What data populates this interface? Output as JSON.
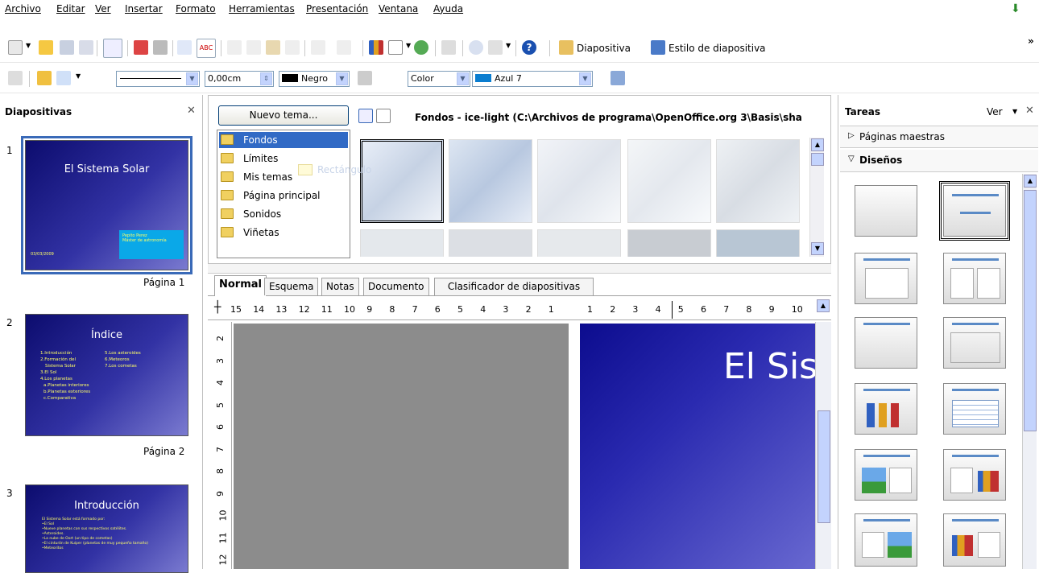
{
  "menu": [
    "Archivo",
    "Editar",
    "Ver",
    "Insertar",
    "Formato",
    "Herramientas",
    "Presentación",
    "Ventana",
    "Ayuda"
  ],
  "toolbar2": {
    "slide_label": "Diapositiva",
    "slide_design_label": "Estilo de diapositiva",
    "more": "»"
  },
  "toolbar3": {
    "line_width": "0,00cm",
    "line_color": "Negro",
    "area_style": "Color",
    "area_color": "Azul 7"
  },
  "slides_panel": {
    "title": "Diapositivas",
    "close": "✕",
    "slides": [
      {
        "num": "1",
        "title": "El Sistema Solar",
        "caption": "Página 1",
        "box_line1": "Pepito Perez",
        "box_line2": "Máster de astronomía",
        "date": "03/03/2009"
      },
      {
        "num": "2",
        "title": "Índice",
        "caption": "Página 2",
        "col1": [
          "1.Introducción",
          "2.Formación del",
          "Sistema Solar",
          "3.El Sol",
          "4.Los planetas",
          "a.Planetas interiores",
          "b.Planetas exteriores",
          "c.Comparativa"
        ],
        "col2": [
          "5.Los asteroides",
          "6.Meteoros",
          "7.Los cometas"
        ]
      },
      {
        "num": "3",
        "title": "Introducción",
        "lines": [
          "El Sistema Solar está formado por:",
          "•El Sol",
          "•Nueve planetas con sus respectivos satélites.",
          "•Asteroides.",
          "•La nube de Oort (un tipo de cometas)",
          "•El cinturón de Kuiper (planetas de muy pequeño tamaño)",
          "•Meteoritos"
        ]
      }
    ]
  },
  "gallery": {
    "new_theme": "Nuevo tema...",
    "path": "Fondos - ice-light (C:\\Archivos de programa\\OpenOffice.org 3\\Basis\\sha",
    "themes": [
      "Fondos",
      "Límites",
      "Mis temas",
      "Página principal",
      "Sonidos",
      "Viñetas"
    ],
    "drag_label": "Rectángulo"
  },
  "tabs": [
    "Normal",
    "Esquema",
    "Notas",
    "Documento",
    "Clasificador de diapositivas"
  ],
  "ruler_h": [
    "15",
    "14",
    "13",
    "12",
    "11",
    "10",
    "9",
    "8",
    "7",
    "6",
    "5",
    "4",
    "3",
    "2",
    "1",
    "1",
    "2",
    "3",
    "4",
    "5",
    "6",
    "7",
    "8",
    "9",
    "10"
  ],
  "ruler_v": [
    "2",
    "3",
    "4",
    "5",
    "6",
    "7",
    "8",
    "9",
    "10",
    "11",
    "12"
  ],
  "canvas": {
    "slide_title": "El Sis"
  },
  "tasks": {
    "title": "Tareas",
    "view": "Ver",
    "close": "✕",
    "master_pages": "Páginas maestras",
    "layouts": "Diseños"
  },
  "colors": {
    "accent": "#0a5ad0",
    "slide_dark": "#0c0c6e",
    "slide_light": "#7a7ad0",
    "thumb_text": "#ffff66"
  }
}
